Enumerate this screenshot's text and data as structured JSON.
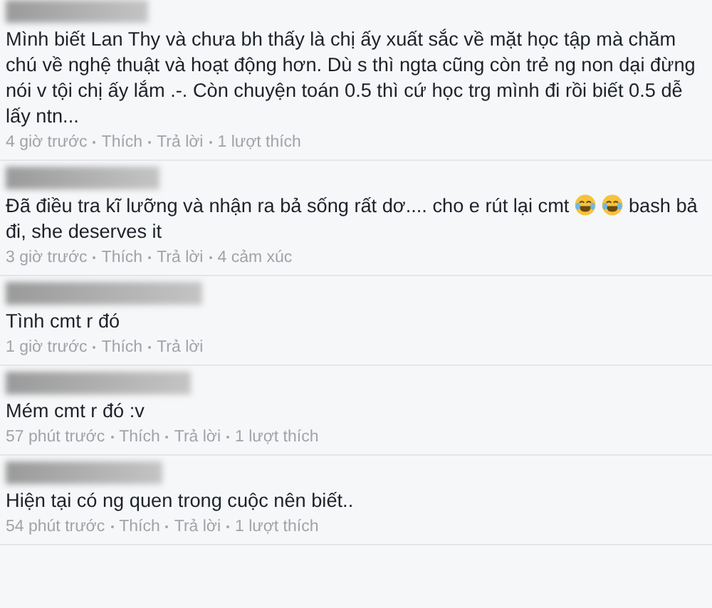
{
  "comments": [
    {
      "parts": [
        {
          "kind": "text",
          "text": "Mình biết Lan Thy và chưa bh thấy là chị ấy xuất sắc về mặt học tập mà chăm chú về nghệ thuật và hoạt động hơn. Dù s thì ngta cũng còn trẻ ng non dại đừng nói v tội chị ấy lắm .-. Còn chuyện toán 0.5 thì cứ học trg mình đi rồi biết 0.5 dễ lấy ntn..."
        }
      ],
      "meta": [
        "4 giờ trước",
        "Thích",
        "Trả lời",
        "1 lượt thích"
      ]
    },
    {
      "parts": [
        {
          "kind": "text",
          "text": "Đã điều tra kĩ lưỡng và nhận ra bả sống rất dơ.... cho e rút lại cmt"
        },
        {
          "kind": "emoji"
        },
        {
          "kind": "emoji"
        },
        {
          "kind": "text",
          "text": "bash bả đi, she deserves it"
        }
      ],
      "meta": [
        "3 giờ trước",
        "Thích",
        "Trả lời",
        "4 cảm xúc"
      ]
    },
    {
      "parts": [
        {
          "kind": "text",
          "text": "Tình cmt r đó"
        }
      ],
      "meta": [
        "1 giờ trước",
        "Thích",
        "Trả lời"
      ]
    },
    {
      "parts": [
        {
          "kind": "text",
          "text": "Mém cmt r đó :v"
        }
      ],
      "meta": [
        "57 phút trước",
        "Thích",
        "Trả lời",
        "1 lượt thích"
      ]
    },
    {
      "parts": [
        {
          "kind": "text",
          "text": "Hiện tại có ng quen trong cuộc nên biết.."
        }
      ],
      "meta": [
        "54 phút trước",
        "Thích",
        "Trả lời",
        "1 lượt thích"
      ]
    }
  ]
}
